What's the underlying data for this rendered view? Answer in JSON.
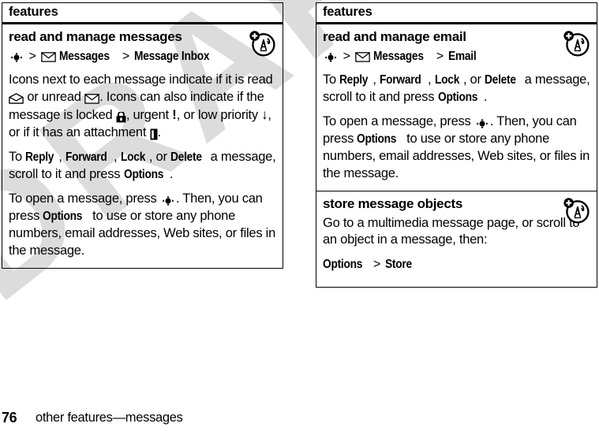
{
  "watermark": "DRAFT",
  "colors": {
    "text": "#000000",
    "background": "#ffffff",
    "watermark": "#dcdcdc",
    "rule": "#000000"
  },
  "left_table": {
    "header": "features",
    "sections": [
      {
        "title": "read and manage messages",
        "badge_icon": "wireless-tower-badge-icon",
        "path": {
          "nav_icon": "nav-key-icon",
          "sep1": ">",
          "message_icon": "envelope-icon",
          "item1": "Messages",
          "sep2": ">",
          "item2": "Message Inbox"
        },
        "paragraphs": [
          {
            "id": "icons-explain",
            "parts": [
              {
                "t": "text",
                "v": "Icons next to each message indicate if it is read "
              },
              {
                "t": "icon",
                "v": "envelope-open-icon"
              },
              {
                "t": "text",
                "v": " or unread "
              },
              {
                "t": "icon",
                "v": "envelope-closed-icon"
              },
              {
                "t": "text",
                "v": ". Icons can also indicate if the message is locked "
              },
              {
                "t": "icon",
                "v": "lock-icon"
              },
              {
                "t": "text",
                "v": ", urgent "
              },
              {
                "t": "icon",
                "v": "exclamation-icon"
              },
              {
                "t": "text",
                "v": ", or low priority "
              },
              {
                "t": "icon",
                "v": "arrow-down-icon"
              },
              {
                "t": "text",
                "v": ", or if it has an attachment "
              },
              {
                "t": "icon",
                "v": "attachment-icon"
              },
              {
                "t": "text",
                "v": "."
              }
            ]
          },
          {
            "id": "reply-forward",
            "parts": [
              {
                "t": "text",
                "v": "To "
              },
              {
                "t": "ui",
                "v": "Reply"
              },
              {
                "t": "text",
                "v": ", "
              },
              {
                "t": "ui",
                "v": "Forward"
              },
              {
                "t": "text",
                "v": ", "
              },
              {
                "t": "ui",
                "v": "Lock"
              },
              {
                "t": "text",
                "v": ", or "
              },
              {
                "t": "ui",
                "v": "Delete"
              },
              {
                "t": "text",
                "v": " a message, scroll to it and press "
              },
              {
                "t": "ui",
                "v": "Options"
              },
              {
                "t": "text",
                "v": "."
              }
            ]
          },
          {
            "id": "open-message",
            "parts": [
              {
                "t": "text",
                "v": "To open a message, press "
              },
              {
                "t": "icon",
                "v": "nav-key-icon"
              },
              {
                "t": "text",
                "v": ". Then, you can press "
              },
              {
                "t": "ui",
                "v": "Options"
              },
              {
                "t": "text",
                "v": " to use or store any phone numbers, email addresses, Web sites, or files in the message."
              }
            ]
          }
        ]
      }
    ]
  },
  "right_table": {
    "header": "features",
    "sections": [
      {
        "title": "read and manage email",
        "badge_icon": "wireless-tower-badge-icon",
        "path": {
          "nav_icon": "nav-key-icon",
          "sep1": ">",
          "message_icon": "envelope-icon",
          "item1": "Messages",
          "sep2": ">",
          "item2": "Email"
        },
        "paragraphs": [
          {
            "id": "reply-forward-email",
            "parts": [
              {
                "t": "text",
                "v": "To "
              },
              {
                "t": "ui",
                "v": "Reply"
              },
              {
                "t": "text",
                "v": ", "
              },
              {
                "t": "ui",
                "v": "Forward"
              },
              {
                "t": "text",
                "v": ", "
              },
              {
                "t": "ui",
                "v": "Lock"
              },
              {
                "t": "text",
                "v": ", or "
              },
              {
                "t": "ui",
                "v": "Delete"
              },
              {
                "t": "text",
                "v": " a message, scroll to it and press "
              },
              {
                "t": "ui",
                "v": "Options"
              },
              {
                "t": "text",
                "v": "."
              }
            ]
          },
          {
            "id": "open-message-email",
            "parts": [
              {
                "t": "text",
                "v": "To open a message, press "
              },
              {
                "t": "icon",
                "v": "nav-key-icon"
              },
              {
                "t": "text",
                "v": ". Then, you can press "
              },
              {
                "t": "ui",
                "v": "Options"
              },
              {
                "t": "text",
                "v": " to use or store any phone numbers, email addresses, Web sites, or files in the message."
              }
            ]
          }
        ]
      },
      {
        "title": "store message objects",
        "badge_icon": "wireless-tower-badge-icon",
        "paragraphs": [
          {
            "id": "store-objects",
            "parts": [
              {
                "t": "text",
                "v": "Go to a multimedia message page, or scroll to an object in a message, then:"
              }
            ]
          }
        ],
        "trailing_path": {
          "item1": "Options",
          "sep": ">",
          "item2": "Store"
        }
      }
    ]
  },
  "footer": {
    "page_number": "76",
    "title": "other features—messages"
  }
}
